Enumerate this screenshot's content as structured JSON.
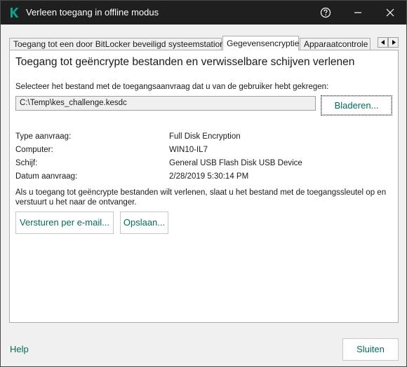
{
  "window": {
    "title": "Verleen toegang in offline modus",
    "icon": "kaspersky-k-icon",
    "accent": "#006d5b"
  },
  "tabs": [
    {
      "label": "Toegang tot een door BitLocker beveiligd systeemstation",
      "active": false
    },
    {
      "label": "Gegevensencryptie",
      "active": true
    },
    {
      "label": "Apparaatcontrole",
      "active": false
    }
  ],
  "panel": {
    "heading": "Toegang tot geëncrypte bestanden en verwisselbare schijven verlenen",
    "instruction": "Selecteer het bestand met de toegangsaanvraag dat u van de gebruiker hebt gekregen:",
    "file_path": "C:\\Temp\\kes_challenge.kesdc",
    "browse_label": "Bladeren...",
    "info": [
      {
        "label": "Type aanvraag:",
        "value": "Full Disk Encryption"
      },
      {
        "label": "Computer:",
        "value": "WIN10-IL7"
      },
      {
        "label": "Schijf:",
        "value": "General USB Flash Disk USB Device"
      },
      {
        "label": "Datum aanvraag:",
        "value": "2/28/2019 5:30:14 PM"
      }
    ],
    "note": "Als u toegang tot geëncrypte bestanden wilt verlenen, slaat u het bestand met de toegangssleutel op en verstuurt u het naar de ontvanger.",
    "email_label": "Versturen per e-mail...",
    "save_label": "Opslaan..."
  },
  "footer": {
    "help_label": "Help",
    "close_label": "Sluiten"
  }
}
